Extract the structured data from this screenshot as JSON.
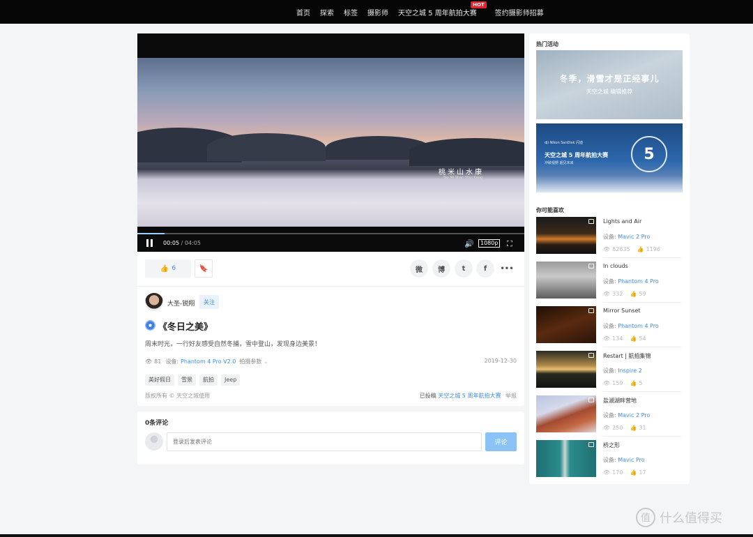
{
  "nav": {
    "items": [
      "首页",
      "探索",
      "标签",
      "摄影师",
      "天空之城 5 周年航拍大赛",
      "签约摄影师招募"
    ],
    "hot_badge": "HOT"
  },
  "video": {
    "caption": "桃米山水康",
    "caption_sub": "Tao Mi Shan Shui Kang",
    "current_time": "00:05",
    "separator": "/",
    "duration": "04:05",
    "resolution": "1080p",
    "progress_fraction": 0.02
  },
  "actions": {
    "like_count": "6",
    "share_icons": [
      "wechat-icon",
      "weibo-icon",
      "twitter-icon",
      "facebook-icon",
      "more-icon"
    ]
  },
  "author": {
    "name": "大圣-锐翔",
    "follow_label": "关注"
  },
  "post": {
    "title": "《冬日之美》",
    "description": "周末时光，一行好友感受自然冬捕，雪中登山，发现身边美景！",
    "views": "81",
    "device_label": "设备:",
    "device": "Phantom 4 Pro V2.0",
    "params_label": "拍摄参数",
    "date": "2019-12-30",
    "tags": [
      "美好假日",
      "雪景",
      "航拍",
      "Jeep"
    ],
    "copyright": "版权所有 © 天空之城使用",
    "submitted_label": "已投稿",
    "submitted_to": "天空之城 5 周年航拍大赛",
    "report_label": "举报"
  },
  "comments": {
    "title": "0条评论",
    "placeholder": "登录后发表评论",
    "submit_label": "评论"
  },
  "sidebar": {
    "hot_title": "热门活动",
    "banner1": {
      "title": "冬季，滑雪才是正经事儿",
      "subtitle": "天空之城 编辑推荐"
    },
    "banner2": {
      "logos": "dji   Nikon   SanDisk  闪迪",
      "title": "天空之城 5 周年航拍大赛",
      "subtitle": "冲破视野 超见未来",
      "badge": "5"
    },
    "rec_title": "你可能喜欢",
    "recommendations": [
      {
        "name": "Lights and Air",
        "device_label": "设备:",
        "device": "Mavic 2 Pro",
        "views": "82635",
        "likes": "1196"
      },
      {
        "name": "In clouds",
        "device_label": "设备:",
        "device": "Phantom 4 Pro",
        "views": "332",
        "likes": "59"
      },
      {
        "name": "Mirror Sunset",
        "device_label": "设备:",
        "device": "Phantom 4 Pro",
        "views": "134",
        "likes": "54"
      },
      {
        "name": "Restart | 航拍集锦",
        "device_label": "设备:",
        "device": "Inspire 2",
        "views": "159",
        "likes": "5"
      },
      {
        "name": "盐湖湖畔营地",
        "device_label": "设备:",
        "device": "Mavic 2 Pro",
        "views": "250",
        "likes": "31"
      },
      {
        "name": "桥之形",
        "device_label": "设备:",
        "device": "Mavic Pro",
        "views": "170",
        "likes": "17"
      }
    ]
  },
  "watermark": {
    "text": "什么值得买",
    "icon": "值"
  }
}
